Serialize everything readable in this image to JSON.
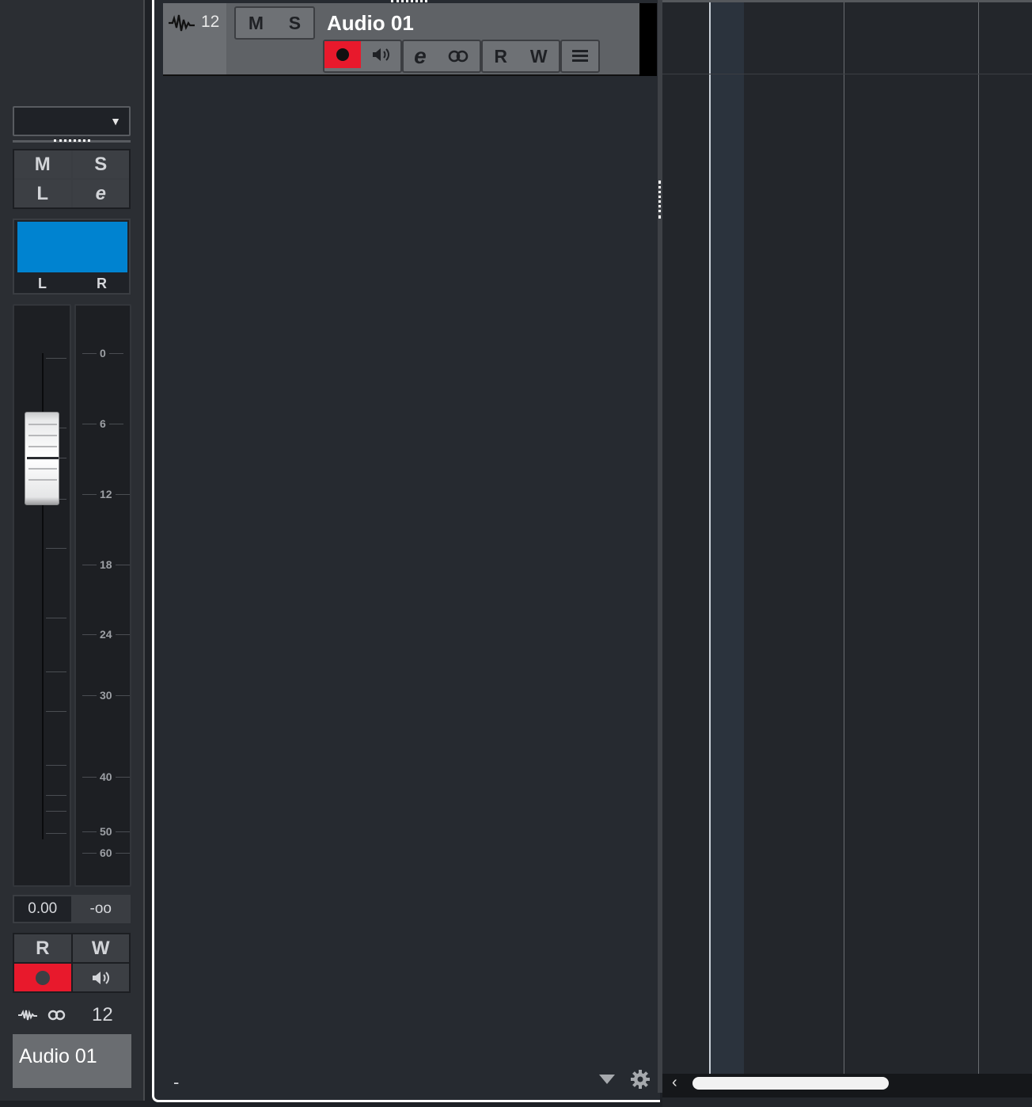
{
  "inspector": {
    "dropdown_value": "",
    "dropdown_arrow": "▼",
    "buttons": {
      "mute": "M",
      "solo": "S",
      "listen": "L",
      "edit": "e"
    },
    "pan_left": "L",
    "pan_right": "R",
    "meter_scale": [
      "0",
      "6",
      "12",
      "18",
      "24",
      "30",
      "40",
      "50",
      "60"
    ],
    "volume": "0.00",
    "peak": "-oo",
    "read": "R",
    "write": "W",
    "track_number": "12",
    "track_name": "Audio 01"
  },
  "track": {
    "number": "12",
    "name": "Audio 01",
    "mute": "M",
    "solo": "S",
    "read": "R",
    "write": "W",
    "edit": "e"
  },
  "tracklist_footer": {
    "dash": "-"
  },
  "colors": {
    "record": "#e8192c",
    "pan_meter": "#0083d0",
    "background": "#262a30"
  },
  "icons": [
    "waveform-icon",
    "record-icon",
    "monitor-icon",
    "edit-icon",
    "link-icon",
    "list-icon",
    "gear-icon",
    "chevron-down-icon",
    "scroll-left-icon"
  ]
}
